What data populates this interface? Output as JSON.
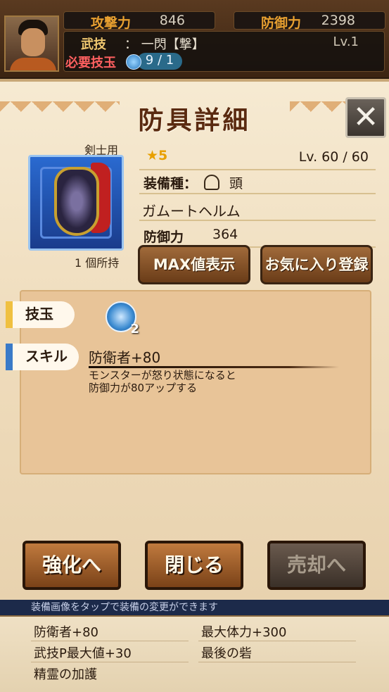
{
  "header": {
    "attack_label": "攻撃力",
    "attack_value": "846",
    "defense_label": "防御力",
    "defense_value": "2398",
    "skill_label": "武技",
    "skill_value": "： 一閃【撃】",
    "level": "Lv.1",
    "required_label": "必要技玉",
    "required_value": "9 / 1"
  },
  "panel": {
    "title": "防具詳細",
    "close_icon": "close-icon"
  },
  "item": {
    "usage": "剣士用",
    "owned": "1 個所持",
    "rarity": "★5",
    "level": "Lv. 60 / 60",
    "slot_label": "装備種：",
    "slot_value": "頭",
    "name": "ガムートヘルム",
    "defense_label": "防御力",
    "defense_value": "364"
  },
  "buttons": {
    "max_value": "MAX値表示",
    "favorite": "お気に入り登録",
    "enhance": "強化へ",
    "close": "閉じる",
    "sell": "売却へ"
  },
  "detail": {
    "slots_tag": "技玉",
    "jewel_count": "2",
    "skill_tag": "スキル",
    "skill_name": "防衛者+80",
    "skill_desc_1": "モンスターが怒り状態になると",
    "skill_desc_2": "防御力が80アップする"
  },
  "bottom": {
    "ticker": "装備画像をタップで装備の変更ができます",
    "items": [
      "防衛者+80",
      "最大体力+300",
      "武技P最大値+30",
      "最後の砦",
      "精霊の加護"
    ]
  }
}
